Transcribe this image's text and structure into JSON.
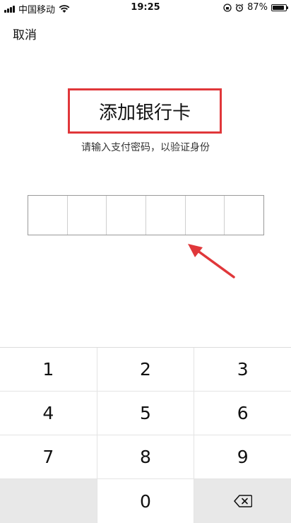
{
  "status_bar": {
    "carrier": "中国移动",
    "time": "19:25",
    "battery": "87%",
    "battery_level": 0.87
  },
  "nav": {
    "cancel_label": "取消"
  },
  "header": {
    "title": "添加银行卡",
    "subtitle": "请输入支付密码，以验证身份",
    "highlight_color": "#e0373a"
  },
  "pin": {
    "length": 6
  },
  "keypad": {
    "rows": [
      [
        "1",
        "2",
        "3"
      ],
      [
        "4",
        "5",
        "6"
      ],
      [
        "7",
        "8",
        "9"
      ],
      [
        "",
        "0",
        "delete-icon"
      ]
    ]
  }
}
